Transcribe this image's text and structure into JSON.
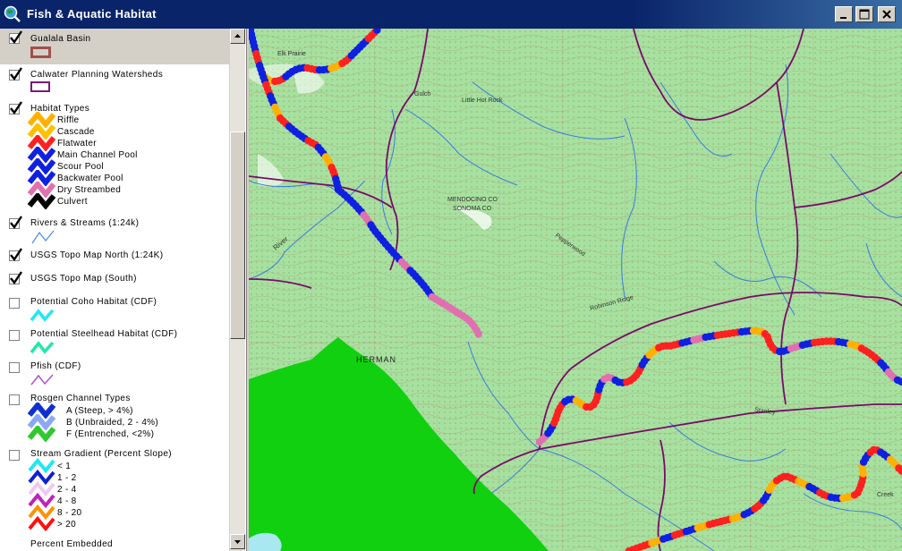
{
  "window": {
    "title": "Fish & Aquatic Habitat"
  },
  "toc": {
    "layers": [
      {
        "name": "Gualala Basin",
        "checked": true,
        "color": "#a0504a"
      },
      {
        "name": "Calwater Planning Watersheds",
        "checked": true,
        "color": "#7a1a7a"
      },
      {
        "name": "Habitat Types",
        "checked": true,
        "classes": [
          {
            "label": "Riffle",
            "color": "#ffb000"
          },
          {
            "label": "Cascade",
            "color": "#ffc000"
          },
          {
            "label": "Flatwater",
            "color": "#ff2020"
          },
          {
            "label": "Main Channel Pool",
            "color": "#1020e0"
          },
          {
            "label": "Scour Pool",
            "color": "#1020e0"
          },
          {
            "label": "Backwater Pool",
            "color": "#1020e0"
          },
          {
            "label": "Dry Streambed",
            "color": "#e070b0"
          },
          {
            "label": "Culvert",
            "color": "#000000"
          }
        ]
      },
      {
        "name": "Rivers & Streams (1:24k)",
        "checked": true,
        "color": "#4a8ae8"
      },
      {
        "name": "USGS Topo Map North (1:24K)",
        "checked": true
      },
      {
        "name": "USGS Topo Map (South)",
        "checked": true
      },
      {
        "name": "Potential Coho Habitat (CDF)",
        "checked": false,
        "color": "#20e8f0"
      },
      {
        "name": "Potential Steelhead Habitat (CDF)",
        "checked": false,
        "color": "#20e8a8"
      },
      {
        "name": "Pfish (CDF)",
        "checked": false,
        "color": "#b050d0"
      },
      {
        "name": "Rosgen Channel Types",
        "checked": false,
        "classes": [
          {
            "label": "A  (Steep, > 4%)",
            "color": "#1030d0"
          },
          {
            "label": "B  (Unbraided, 2 - 4%)",
            "color": "#8aa8f8"
          },
          {
            "label": "F  (Entrenched, <2%)",
            "color": "#30c830"
          }
        ]
      },
      {
        "name": "Stream Gradient (Percent Slope)",
        "checked": false,
        "classes": [
          {
            "label": "< 1",
            "color": "#20e8f0"
          },
          {
            "label": "1 - 2",
            "color": "#1020d0"
          },
          {
            "label": "2 - 4",
            "color": "#f0c8f0"
          },
          {
            "label": "4 - 8",
            "color": "#c020c0"
          },
          {
            "label": "8 - 20",
            "color": "#ff9000"
          },
          {
            "label": "> 20",
            "color": "#ff1010"
          }
        ]
      },
      {
        "name": "Percent Embedded",
        "checked": false
      }
    ]
  },
  "map": {
    "labels": {
      "elk_prairie": "Elk Prairie",
      "gulch": "Gulch",
      "little_hot_rock": "Little Hot Rock",
      "county_line_1": "MENDOCINO CO",
      "county_line_2": "SONOMA CO",
      "river": "River",
      "pepperwood": "Pepperwood",
      "robinson_ridge": "Robinson Ridge",
      "herman": "HERMAN",
      "stanley": "Stanley",
      "creek": "Creek"
    },
    "colors": {
      "land": "#a8e0a0",
      "water_area": "#10d010",
      "watershed_line": "#7a0a6a"
    }
  }
}
